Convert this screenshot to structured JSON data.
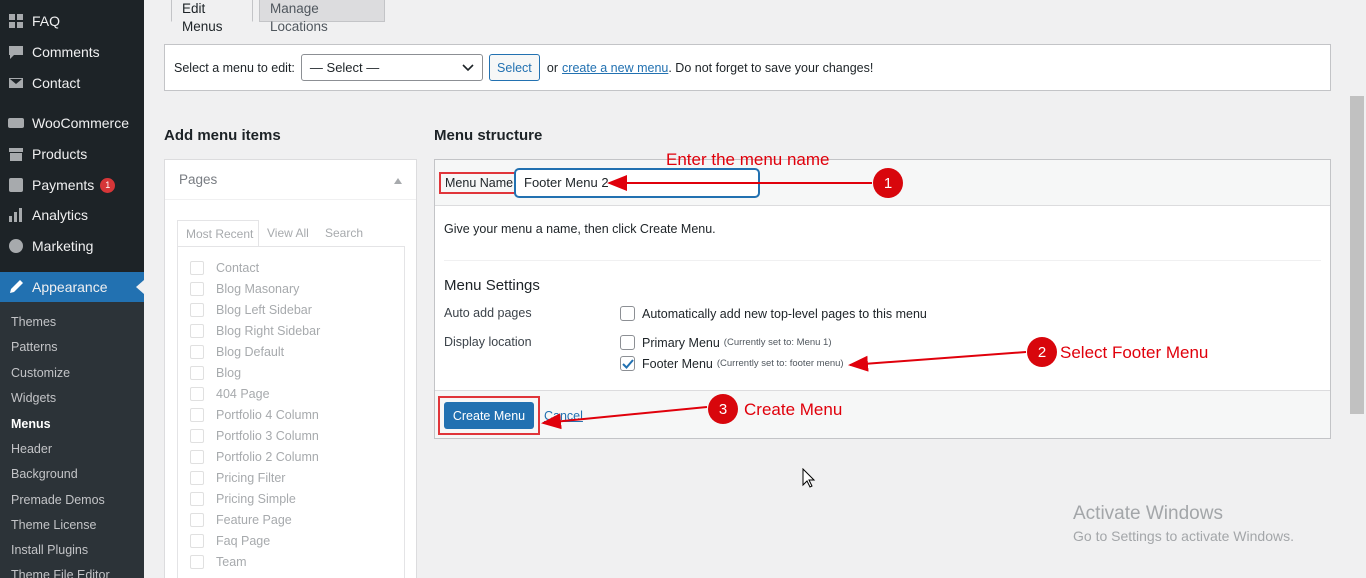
{
  "sidebar": {
    "items": [
      {
        "label": "FAQ",
        "icon": "faq-icon"
      },
      {
        "label": "Comments",
        "icon": "comments-icon"
      },
      {
        "label": "Contact",
        "icon": "mail-icon"
      },
      {
        "label": "WooCommerce",
        "icon": "woocommerce-icon"
      },
      {
        "label": "Products",
        "icon": "archive-icon"
      },
      {
        "label": "Payments",
        "icon": "payments-icon",
        "badge": "1"
      },
      {
        "label": "Analytics",
        "icon": "chart-icon"
      },
      {
        "label": "Marketing",
        "icon": "megaphone-icon"
      },
      {
        "label": "Appearance",
        "icon": "brush-icon"
      }
    ],
    "submenu": [
      "Themes",
      "Patterns",
      "Customize",
      "Widgets",
      "Menus",
      "Header",
      "Background",
      "Premade Demos",
      "Theme License",
      "Install Plugins",
      "Theme File Editor"
    ]
  },
  "tabs": {
    "edit": "Edit Menus",
    "manage": "Manage Locations"
  },
  "select_bar": {
    "label": "Select a menu to edit:",
    "select_value": "— Select —",
    "button": "Select",
    "or": "or",
    "create_link": "create a new menu",
    "suffix": ". Do not forget to save your changes!"
  },
  "add_items": {
    "title": "Add menu items",
    "panel_title": "Pages",
    "tabs": [
      "Most Recent",
      "View All",
      "Search"
    ],
    "pages": [
      "Contact",
      "Blog Masonary",
      "Blog Left Sidebar",
      "Blog Right Sidebar",
      "Blog Default",
      "Blog",
      "404 Page",
      "Portfolio 4 Column",
      "Portfolio 3 Column",
      "Portfolio 2 Column",
      "Pricing Filter",
      "Pricing Simple",
      "Feature Page",
      "Faq Page",
      "Team"
    ]
  },
  "structure": {
    "title": "Menu structure",
    "name_label": "Menu Name",
    "name_value": "Footer Menu 2",
    "intro": "Give your menu a name, then click Create Menu.",
    "settings_title": "Menu Settings",
    "auto_add_label": "Auto add pages",
    "auto_add_option": "Automatically add new top-level pages to this menu",
    "display_label": "Display location",
    "primary_option": "Primary Menu",
    "primary_note": "(Currently set to: Menu 1)",
    "footer_option": "Footer Menu",
    "footer_note": "(Currently set to: footer menu)",
    "create_button": "Create Menu",
    "cancel": "Cancel"
  },
  "annotations": {
    "a1_text": "Enter the menu name",
    "a1_num": "1",
    "a2_text": "Select Footer Menu",
    "a2_num": "2",
    "a3_text": "Create Menu",
    "a3_num": "3",
    "color": "#e0000b"
  },
  "watermark": {
    "line1": "Activate Windows",
    "line2": "Go to Settings to activate Windows."
  },
  "colors": {
    "sidebar": "#1d2327",
    "accent": "#2271b1",
    "annotation": "#e0000b"
  }
}
